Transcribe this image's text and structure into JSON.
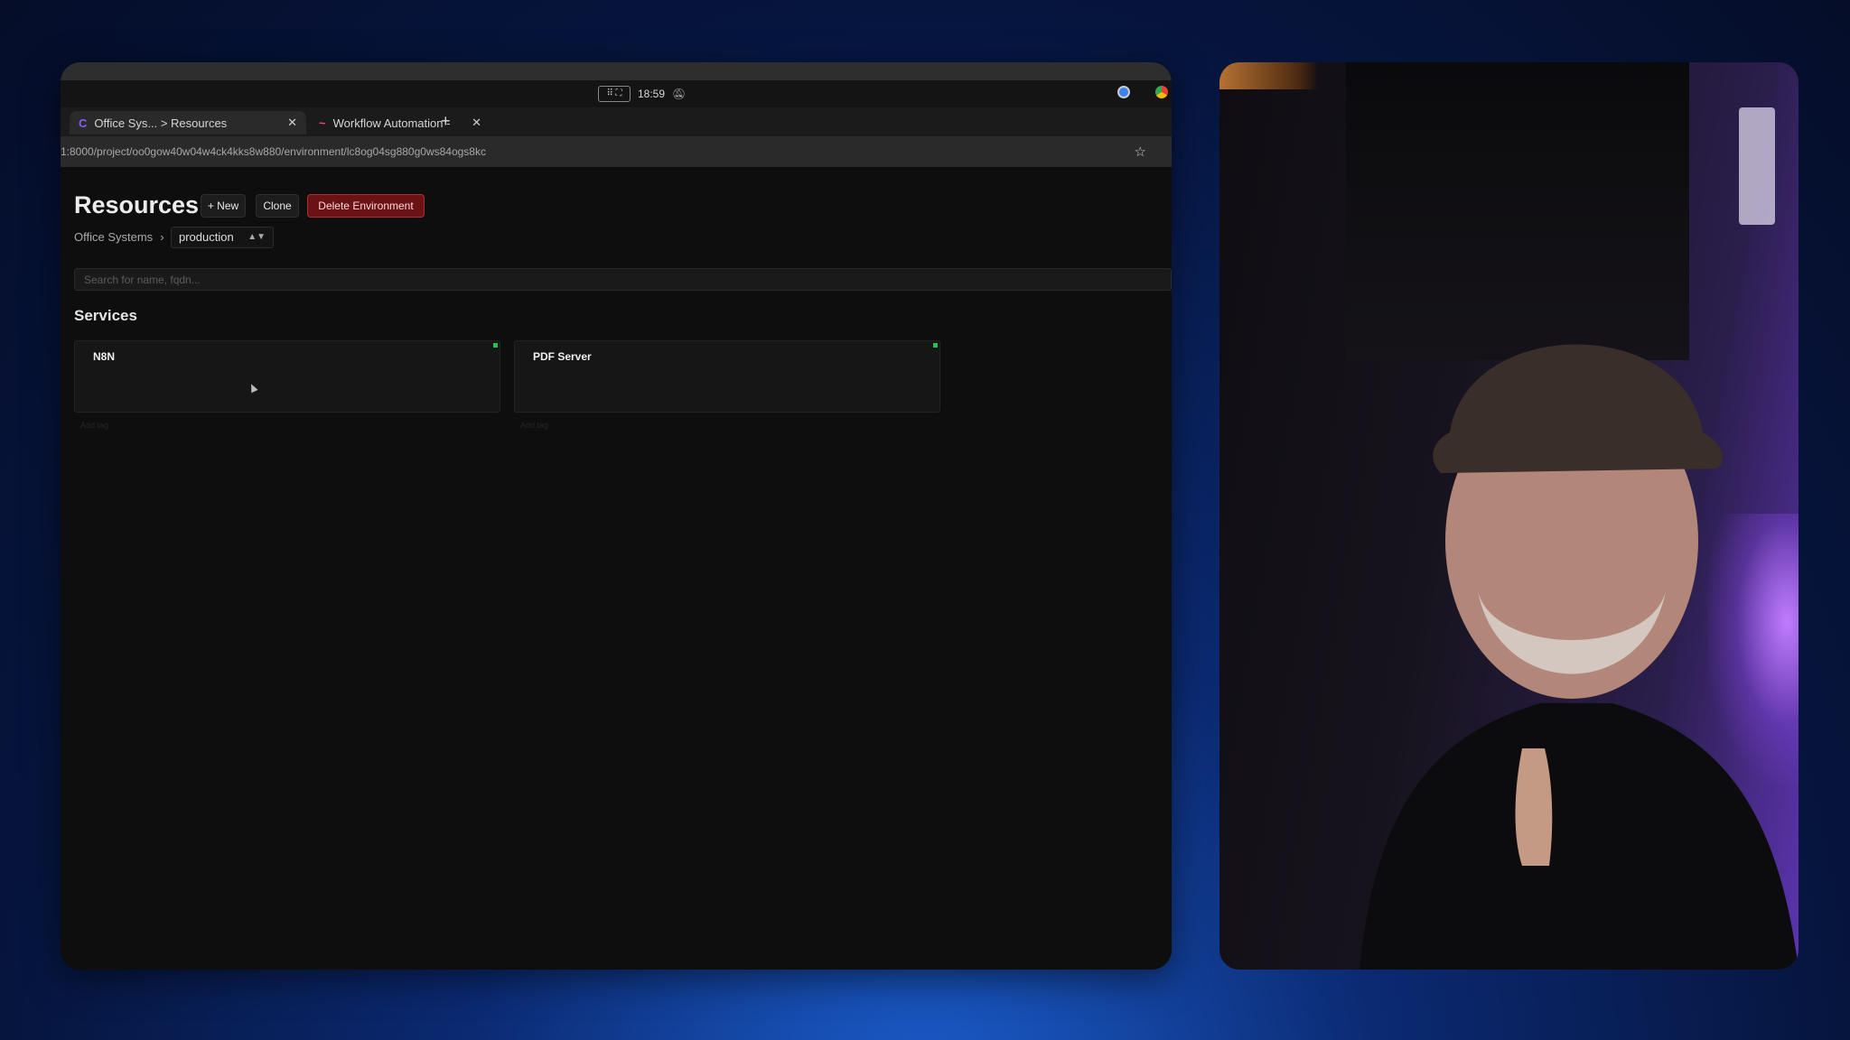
{
  "menubar": {
    "time": "18:59"
  },
  "tabs": [
    {
      "label": "Office Sys... > Resources",
      "active": true
    },
    {
      "label": "Workflow Automation - ",
      "active": false
    }
  ],
  "address": {
    "url": "1:8000/project/oo0gow40w04w4ck4kks8w880/environment/lc8og04sg880g0ws84ogs8kc"
  },
  "page": {
    "title": "Resources",
    "buttons": {
      "new": "+ New",
      "clone": "Clone",
      "delete": "Delete Environment"
    },
    "breadcrumb": {
      "project": "Office Systems",
      "separator": "›"
    },
    "environment": "production",
    "search": {
      "placeholder": "Search for name, fqdn..."
    },
    "services_heading": "Services",
    "services": [
      {
        "name": "N8N",
        "tag": "Add tag",
        "status_color": "#27c24c"
      },
      {
        "name": "PDF Server",
        "tag": "Add tag",
        "status_color": "#27c24c"
      }
    ]
  },
  "colors": {
    "danger": "#6b1214",
    "background": "#0e0e0e",
    "status": "#27c24c"
  }
}
